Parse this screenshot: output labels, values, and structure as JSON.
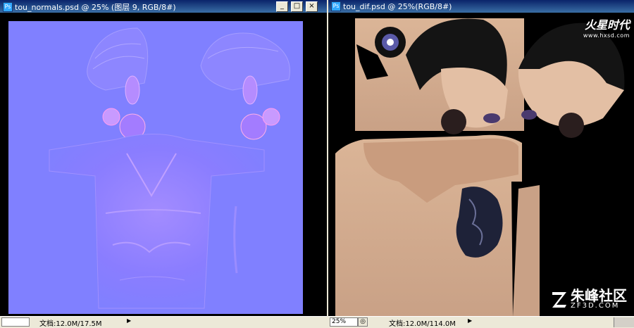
{
  "left_window": {
    "title": "tou_normals.psd @ 25% (图层 9, RGB/8#)",
    "status": {
      "doc_info": "文档:12.0M/17.5M"
    }
  },
  "right_window": {
    "title": "tou_dif.psd @ 25%(RGB/8#)",
    "status": {
      "zoom": "25%",
      "doc_info": "文档:12.0M/114.0M"
    }
  },
  "window_controls": {
    "minimize": "_",
    "maximize": "□",
    "close": "×"
  },
  "watermarks": {
    "top_brand": "火星时代",
    "top_url": "www.hxsd.com",
    "bottom_cn": "朱峰社区",
    "bottom_en": "ZF3D.COM"
  },
  "colors": {
    "normal_map": "#8080ff",
    "skin": "#d2a888",
    "hair": "#141414",
    "titlebar": "#0a246a"
  }
}
